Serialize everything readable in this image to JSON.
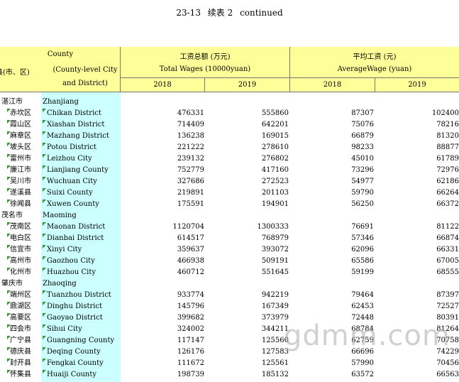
{
  "title": {
    "code": "23-13",
    "cn": "续表 2",
    "en": "continued"
  },
  "header": {
    "county_cn": "县(市、区)",
    "county_en1": "County",
    "county_en2": "(County-level City",
    "county_en3": "and District)",
    "total_cn": "工资总额 (万元)",
    "total_en": "Total Wages (10000yuan)",
    "avg_cn": "平均工资 (元)",
    "avg_en": "AverageWage (yuan)",
    "years": [
      "2018",
      "2019",
      "2018",
      "2019"
    ]
  },
  "rows": [
    {
      "zh": "湛江市",
      "en": "Zhanjiang",
      "city": true
    },
    {
      "zh": "赤坎区",
      "en": "Chikan District",
      "v": [
        "476331",
        "555860",
        "87307",
        "102400"
      ]
    },
    {
      "zh": "霞山区",
      "en": "Xiashan District",
      "v": [
        "714409",
        "642201",
        "75076",
        "78216"
      ]
    },
    {
      "zh": "麻章区",
      "en": "Mazhang District",
      "v": [
        "136238",
        "169015",
        "66879",
        "81320"
      ]
    },
    {
      "zh": "坡头区",
      "en": "Potou District",
      "v": [
        "221222",
        "278610",
        "98233",
        "88877"
      ]
    },
    {
      "zh": "雷州市",
      "en": "Leizhou City",
      "v": [
        "239132",
        "276802",
        "45010",
        "61789"
      ]
    },
    {
      "zh": "廉江市",
      "en": "Lianjiang County",
      "v": [
        "752779",
        "417160",
        "73296",
        "72976"
      ]
    },
    {
      "zh": "吴川市",
      "en": "Wuchuan City",
      "v": [
        "327686",
        "272523",
        "54977",
        "62186"
      ]
    },
    {
      "zh": "遂溪县",
      "en": "Suixi County",
      "v": [
        "219891",
        "201103",
        "59790",
        "66264"
      ]
    },
    {
      "zh": "徐闻县",
      "en": "Xuwen County",
      "v": [
        "175591",
        "194901",
        "56250",
        "66372"
      ]
    },
    {
      "zh": "茂名市",
      "en": "Maoming",
      "city": true
    },
    {
      "zh": "茂南区",
      "en": "Maonan  District",
      "v": [
        "1120704",
        "1300333",
        "76691",
        "81122"
      ]
    },
    {
      "zh": "电白区",
      "en": "Dianbai  District",
      "v": [
        "614517",
        "768979",
        "57346",
        "66874"
      ]
    },
    {
      "zh": "信宜市",
      "en": "Xinyi City",
      "v": [
        "359637",
        "393072",
        "62096",
        "66331"
      ]
    },
    {
      "zh": "高州市",
      "en": "Gaozhou City",
      "v": [
        "466938",
        "509191",
        "65586",
        "67005"
      ]
    },
    {
      "zh": "化州市",
      "en": "Huazhou City",
      "v": [
        "460712",
        "551645",
        "59199",
        "68555"
      ]
    },
    {
      "zh": "肇庆市",
      "en": "Zhaoqing",
      "city": true
    },
    {
      "zh": "端州区",
      "en": "Tuanzhou  District",
      "v": [
        "933774",
        "942219",
        "79464",
        "87397"
      ]
    },
    {
      "zh": "鼎湖区",
      "en": "Dinghu District",
      "v": [
        "145796",
        "167349",
        "62453",
        "72527"
      ]
    },
    {
      "zh": "高要区",
      "en": "Gaoyao  District",
      "v": [
        "399682",
        "373979",
        "72448",
        "80391"
      ]
    },
    {
      "zh": "四会市",
      "en": "Sihui City",
      "v": [
        "324002",
        "344211",
        "68784",
        "81264"
      ]
    },
    {
      "zh": "广宁县",
      "en": "Guangning County",
      "v": [
        "117147",
        "125560",
        "62759",
        "70758"
      ]
    },
    {
      "zh": "德庆县",
      "en": "Deqing County",
      "v": [
        "126176",
        "127583",
        "66696",
        "74229"
      ]
    },
    {
      "zh": "封开县",
      "en": "Fengkai County",
      "v": [
        "111672",
        "125561",
        "57990",
        "70456"
      ]
    },
    {
      "zh": "怀集县",
      "en": "Huaiji County",
      "v": [
        "198739",
        "185132",
        "63572",
        "66563"
      ]
    }
  ],
  "watermark": "gdmm.com"
}
